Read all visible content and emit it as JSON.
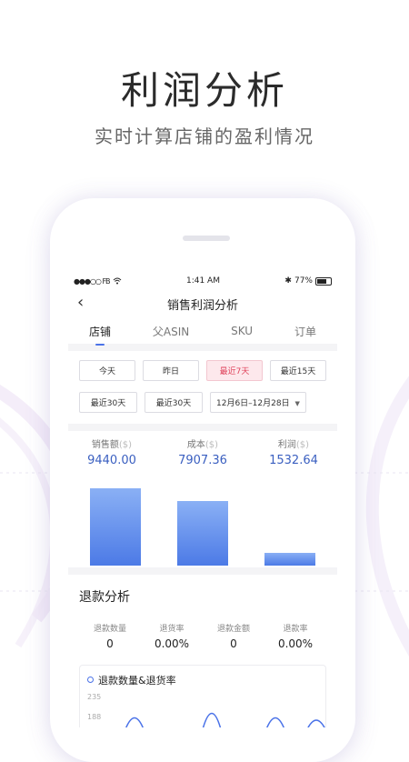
{
  "hero": {
    "title": "利润分析",
    "subtitle": "实时计算店铺的盈利情况"
  },
  "status_bar": {
    "carrier": "●●●○○ FB",
    "time": "1:41 AM",
    "battery": "77%"
  },
  "nav": {
    "back_icon": "chevron-left-icon",
    "title": "销售利润分析"
  },
  "tabs": [
    {
      "label": "店铺",
      "active": true
    },
    {
      "label": "父ASIN",
      "active": false
    },
    {
      "label": "SKU",
      "active": false
    },
    {
      "label": "订单",
      "active": false
    }
  ],
  "filters": {
    "row1": [
      {
        "label": "今天",
        "selected": false
      },
      {
        "label": "昨日",
        "selected": false
      },
      {
        "label": "最近7天",
        "selected": true
      },
      {
        "label": "最近15天",
        "selected": false
      }
    ],
    "row2": [
      {
        "label": "最近30天",
        "selected": false
      },
      {
        "label": "最近30天",
        "selected": false
      }
    ],
    "date_range": "12月6日–12月28日",
    "selected_color": "#e0435b"
  },
  "summary": {
    "metrics": [
      {
        "label": "销售额",
        "currency": "($)",
        "value": "9440.00"
      },
      {
        "label": "成本",
        "currency": "($)",
        "value": "7907.36"
      },
      {
        "label": "利润",
        "currency": "($)",
        "value": "1532.64"
      }
    ],
    "bar_color": "#4c7ae6"
  },
  "refund": {
    "title": "退款分析",
    "stats": [
      {
        "label": "退款数量",
        "value": "0"
      },
      {
        "label": "退货率",
        "value": "0.00%"
      },
      {
        "label": "退款金额",
        "value": "0"
      },
      {
        "label": "退款率",
        "value": "0.00%"
      }
    ],
    "trend_title": "退款数量&退货率",
    "y_ticks": [
      "235",
      "188"
    ]
  },
  "chart_data": {
    "type": "bar",
    "categories": [
      "销售额",
      "成本",
      "利润"
    ],
    "values": [
      9440.0,
      7907.36,
      1532.64
    ],
    "ylim": [
      0,
      10000
    ]
  }
}
